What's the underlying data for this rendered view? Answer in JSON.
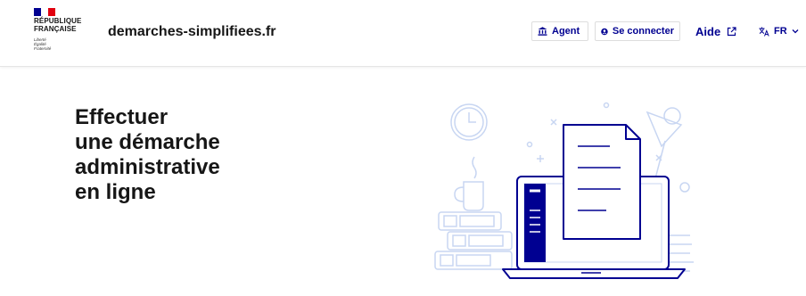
{
  "brand": {
    "flag_colors": [
      "#000091",
      "#ffffff",
      "#e1000f"
    ],
    "name_line1": "RÉPUBLIQUE",
    "name_line2": "FRANÇAISE",
    "motto_line1": "Liberté",
    "motto_line2": "Égalité",
    "motto_line3": "Fraternité",
    "site_name": "demarches-simplifiees.fr"
  },
  "nav": {
    "agent_label": "Agent",
    "agent_icon": "institution-icon",
    "login_label": "Se connecter",
    "login_icon": "account-circle-icon",
    "help_label": "Aide",
    "help_icon": "external-link-icon",
    "language_icon": "translate-icon",
    "language_label": "FR"
  },
  "hero": {
    "line1": "Effectuer",
    "line2": "une démarche",
    "line3": "administrative",
    "line4": "en ligne"
  },
  "colors": {
    "accent": "#000091",
    "illustration_line": "#c8d6f2",
    "text": "#161616"
  }
}
